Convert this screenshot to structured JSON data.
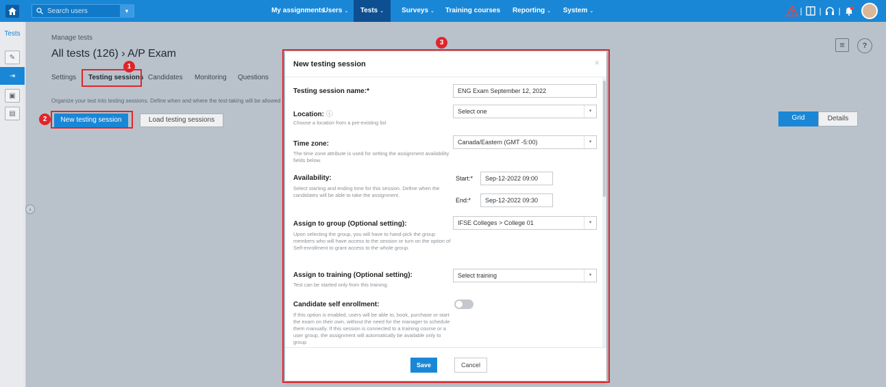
{
  "topbar": {
    "search_placeholder": "Search users",
    "nav": [
      {
        "label": "My assignments",
        "caret": ""
      },
      {
        "label": "Users",
        "caret": "⌄"
      },
      {
        "label": "Tests",
        "caret": "⌄"
      },
      {
        "label": "Surveys",
        "caret": "⌄"
      },
      {
        "label": "Training courses",
        "caret": ""
      },
      {
        "label": "Reporting",
        "caret": "⌄"
      },
      {
        "label": "System",
        "caret": "⌄"
      }
    ]
  },
  "rail": {
    "title": "Tests"
  },
  "page": {
    "breadcrumb": "Manage tests",
    "title": "All tests (126) › A/P Exam",
    "tabs": [
      "Settings",
      "Testing sessions",
      "Candidates",
      "Monitoring",
      "Questions"
    ],
    "hint": "Organize your test into testing sessions. Define when and where the test-taking will be allowed",
    "new_session_btn": "New testing session",
    "load_sessions_btn": "Load testing sessions",
    "view_grid": "Grid",
    "view_details": "Details"
  },
  "annotations": [
    "1",
    "2",
    "3"
  ],
  "modal": {
    "title": "New testing session",
    "close": "×",
    "session_name_label": "Testing session name:*",
    "session_name_value": "ENG Exam September 12, 2022",
    "location_label": "Location:",
    "location_help": "Choose a location from a pre-existing list",
    "location_value": "Select one",
    "timezone_label": "Time zone:",
    "timezone_help": "The time zone attribute is used for setting the assignment availability fields below.",
    "timezone_value": "Canada/Eastern (GMT -5:00)",
    "availability_label": "Availability:",
    "availability_help": "Select starting and ending time for this session. Define when the candidates will be able to take the assignment.",
    "start_label": "Start:*",
    "start_value": "Sep-12-2022 09:00",
    "end_label": "End:*",
    "end_value": "Sep-12-2022 09:30",
    "group_label": "Assign to group (Optional setting):",
    "group_help": "Upon selecting the group, you will have to hand-pick the group members who will have access to the session or turn on the option of Self-enrollment to grant access to the whole group.",
    "group_value": "IFSE Colleges > College 01",
    "training_label": "Assign to training (Optional setting):",
    "training_help": "Test can be started only from this training.",
    "training_value": "Select training",
    "self_enroll_label": "Candidate self enrollment:",
    "self_enroll_help": "If this option is enabled, users will be able to, book, purchase or start the exam on their own, without the need for the manager to schedule them manually. If this session is connected to a training course or a user group, the assignment will automatically be available only to group",
    "save": "Save",
    "cancel": "Cancel"
  }
}
